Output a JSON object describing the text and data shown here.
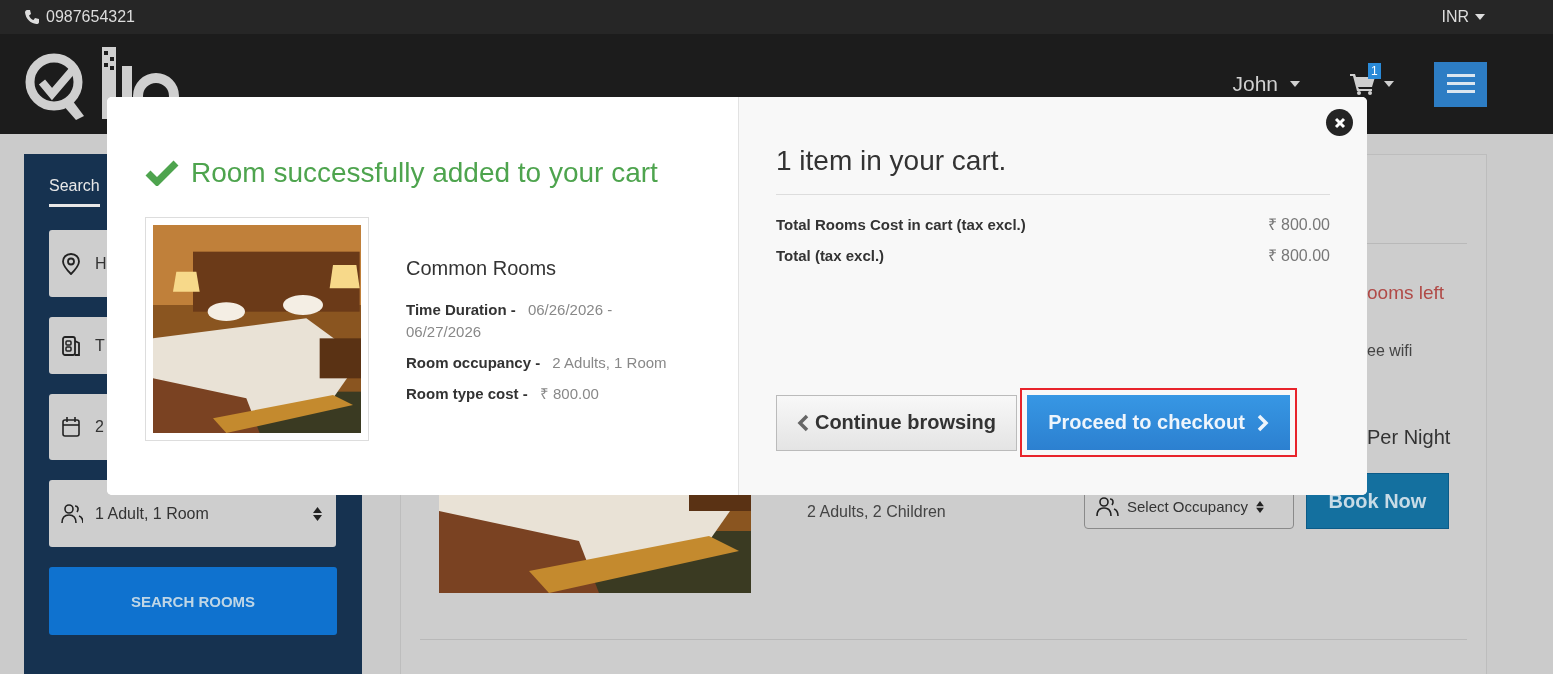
{
  "top_bar": {
    "phone": "0987654321",
    "currency": "INR"
  },
  "header": {
    "user": "John",
    "cart_count": "1"
  },
  "sidebar": {
    "tab": "Search",
    "fields": [
      {
        "kind": "location",
        "value": "H"
      },
      {
        "kind": "hotel",
        "value": "T"
      },
      {
        "kind": "date",
        "value": "2"
      },
      {
        "kind": "occupancy",
        "value": "1 Adult, 1 Room"
      }
    ],
    "button": "SEARCH ROOMS"
  },
  "room_listing": {
    "availability": "ooms left",
    "feature": "ee wifi",
    "price_unit": "Per Night",
    "occupancy": "2 Adults, 2 Children",
    "occupancy_select": "Select Occupancy",
    "book_button": "Book Now"
  },
  "modal": {
    "title": "Room successfully added to your cart",
    "room_name": "Common Rooms",
    "details": [
      {
        "label": "Time Duration -",
        "value": "06/26/2026 - 06/27/2026"
      },
      {
        "label": "Room occupancy -",
        "value": "2 Adults, 1 Room"
      },
      {
        "label": "Room type cost -",
        "value": "₹ 800.00"
      }
    ],
    "cart_heading": "1 item in your cart.",
    "totals": [
      {
        "label": "Total Rooms Cost in cart (tax excl.)",
        "value": "₹ 800.00"
      },
      {
        "label": "Total (tax excl.)",
        "value": "₹ 800.00"
      }
    ],
    "continue_button": "Continue browsing",
    "checkout_button": "Proceed to checkout",
    "checkout_highlighted": true
  }
}
